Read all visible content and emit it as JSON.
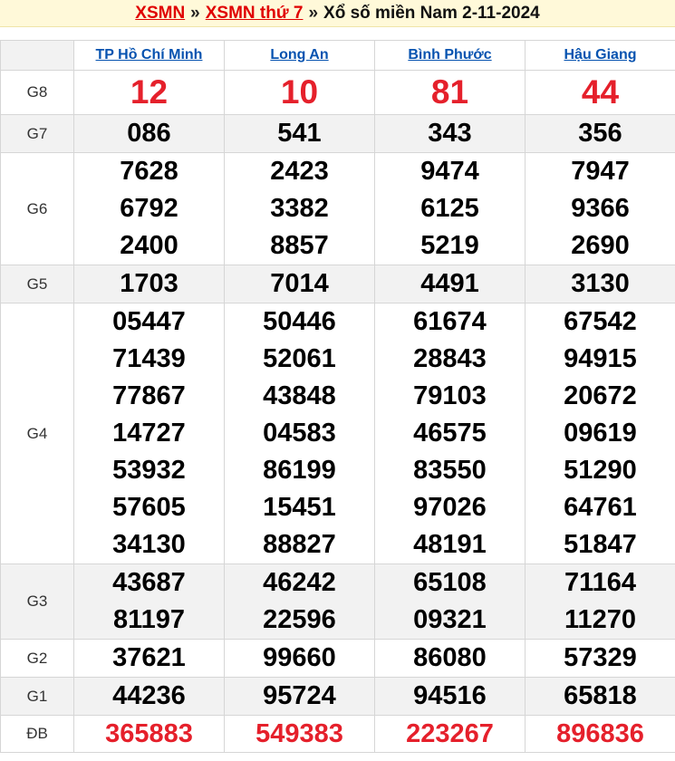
{
  "banner": {
    "link1": "XSMN",
    "sep1": "»",
    "link2": "XSMN thứ 7",
    "sep2": "»",
    "title": "Xổ số miền Nam 2-11-2024"
  },
  "provinces": [
    "TP Hồ Chí Minh",
    "Long An",
    "Bình Phước",
    "Hậu Giang"
  ],
  "rows": [
    {
      "label": "G8",
      "style": "big",
      "shade": "white",
      "values": [
        [
          "12"
        ],
        [
          "10"
        ],
        [
          "81"
        ],
        [
          "44"
        ]
      ]
    },
    {
      "label": "G7",
      "style": "num",
      "shade": "alt",
      "values": [
        [
          "086"
        ],
        [
          "541"
        ],
        [
          "343"
        ],
        [
          "356"
        ]
      ]
    },
    {
      "label": "G6",
      "style": "num",
      "shade": "white",
      "values": [
        [
          "7628",
          "6792",
          "2400"
        ],
        [
          "2423",
          "3382",
          "8857"
        ],
        [
          "9474",
          "6125",
          "5219"
        ],
        [
          "7947",
          "9366",
          "2690"
        ]
      ]
    },
    {
      "label": "G5",
      "style": "num",
      "shade": "alt",
      "values": [
        [
          "1703"
        ],
        [
          "7014"
        ],
        [
          "4491"
        ],
        [
          "3130"
        ]
      ]
    },
    {
      "label": "G4",
      "style": "num",
      "shade": "white",
      "values": [
        [
          "05447",
          "71439",
          "77867",
          "14727",
          "53932",
          "57605",
          "34130"
        ],
        [
          "50446",
          "52061",
          "43848",
          "04583",
          "86199",
          "15451",
          "88827"
        ],
        [
          "61674",
          "28843",
          "79103",
          "46575",
          "83550",
          "97026",
          "48191"
        ],
        [
          "67542",
          "94915",
          "20672",
          "09619",
          "51290",
          "64761",
          "51847"
        ]
      ]
    },
    {
      "label": "G3",
      "style": "num",
      "shade": "alt",
      "values": [
        [
          "43687",
          "81197"
        ],
        [
          "46242",
          "22596"
        ],
        [
          "65108",
          "09321"
        ],
        [
          "71164",
          "11270"
        ]
      ]
    },
    {
      "label": "G2",
      "style": "num",
      "shade": "white",
      "values": [
        [
          "37621"
        ],
        [
          "99660"
        ],
        [
          "86080"
        ],
        [
          "57329"
        ]
      ]
    },
    {
      "label": "G1",
      "style": "num",
      "shade": "alt",
      "values": [
        [
          "44236"
        ],
        [
          "95724"
        ],
        [
          "94516"
        ],
        [
          "65818"
        ]
      ]
    },
    {
      "label": "ĐB",
      "style": "db",
      "shade": "white",
      "values": [
        [
          "365883"
        ],
        [
          "549383"
        ],
        [
          "223267"
        ],
        [
          "896836"
        ]
      ]
    }
  ]
}
